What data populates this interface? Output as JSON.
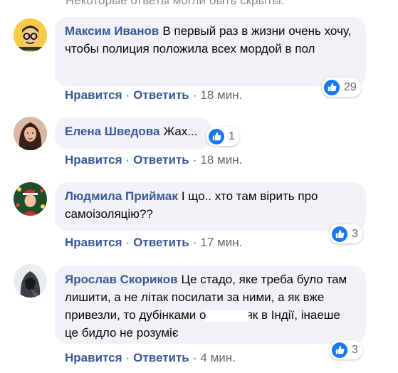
{
  "top_note": "Некоторые ответы могли быть скрыты.",
  "actions": {
    "like": "Нравится",
    "reply": "Ответить",
    "separator": "·"
  },
  "comments": [
    {
      "author": "Максим Иванов",
      "text": "В первый раз в жизни очень хочу, чтобы полиция положила всех мордой в пол",
      "reactions": "29",
      "time": "18 мин.",
      "avatar_icon": "cartoon-man-glasses-icon"
    },
    {
      "author": "Елена Шведова",
      "text": "Жах...",
      "reactions": "1",
      "time": "18 мин.",
      "avatar_icon": "woman-portrait-icon"
    },
    {
      "author": "Людмила Приймак",
      "text": "І що.. хто там вірить про самоізоляцію??",
      "reactions": "3",
      "time": "17 мин.",
      "avatar_icon": "christmas-photo-icon"
    },
    {
      "author": "Ярослав Скориков",
      "text_before": "Це стадо, яке треба було там лишити, а не літак посилати за ними, а як вже привезли, то дубінками от",
      "text_after": "ти, як в Індії, інаеше це бидло не розуміє",
      "reactions": "3",
      "time": "4 мин.",
      "avatar_icon": "hooded-figure-icon"
    }
  ],
  "colors": {
    "author": "#385898",
    "bubble": "#f0f2f5",
    "meta": "#65676b",
    "like": "#1877f2"
  }
}
